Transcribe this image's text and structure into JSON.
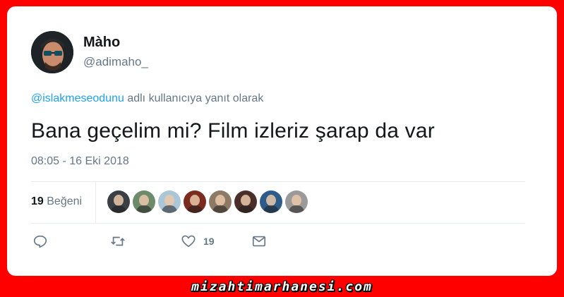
{
  "tweet": {
    "display_name": "Màho",
    "handle": "@adimaho_",
    "reply_mention": "@islakmeseodunu",
    "reply_suffix": " adlı kullanıcıya yanıt olarak",
    "text": "Bana geçelim mi? Film izleriz şarap da var",
    "timestamp": "08:05 - 16 Eki 2018"
  },
  "stats": {
    "likes_count": "19",
    "likes_label": "Beğeni"
  },
  "likers": [
    {
      "icon": "liker-avatar-1",
      "color": "#3a3f45"
    },
    {
      "icon": "liker-avatar-2",
      "color": "#6d8a6a"
    },
    {
      "icon": "liker-avatar-3",
      "color": "#a9c7d6"
    },
    {
      "icon": "liker-avatar-4",
      "color": "#7a2a1f"
    },
    {
      "icon": "liker-avatar-5",
      "color": "#8c7a66"
    },
    {
      "icon": "liker-avatar-6",
      "color": "#4a2e2a"
    },
    {
      "icon": "liker-avatar-7",
      "color": "#2d5c8a"
    },
    {
      "icon": "liker-avatar-8",
      "color": "#9a9a9a"
    }
  ],
  "actions": {
    "reply_icon": "reply-icon",
    "retweet_icon": "retweet-icon",
    "like_icon": "heart-icon",
    "like_count": "19",
    "dm_icon": "envelope-icon"
  },
  "watermark": "mizahtimarhanesi.com",
  "colors": {
    "background": "#ff0000",
    "link": "#1da1f2",
    "muted": "#657786",
    "text": "#14171a"
  }
}
